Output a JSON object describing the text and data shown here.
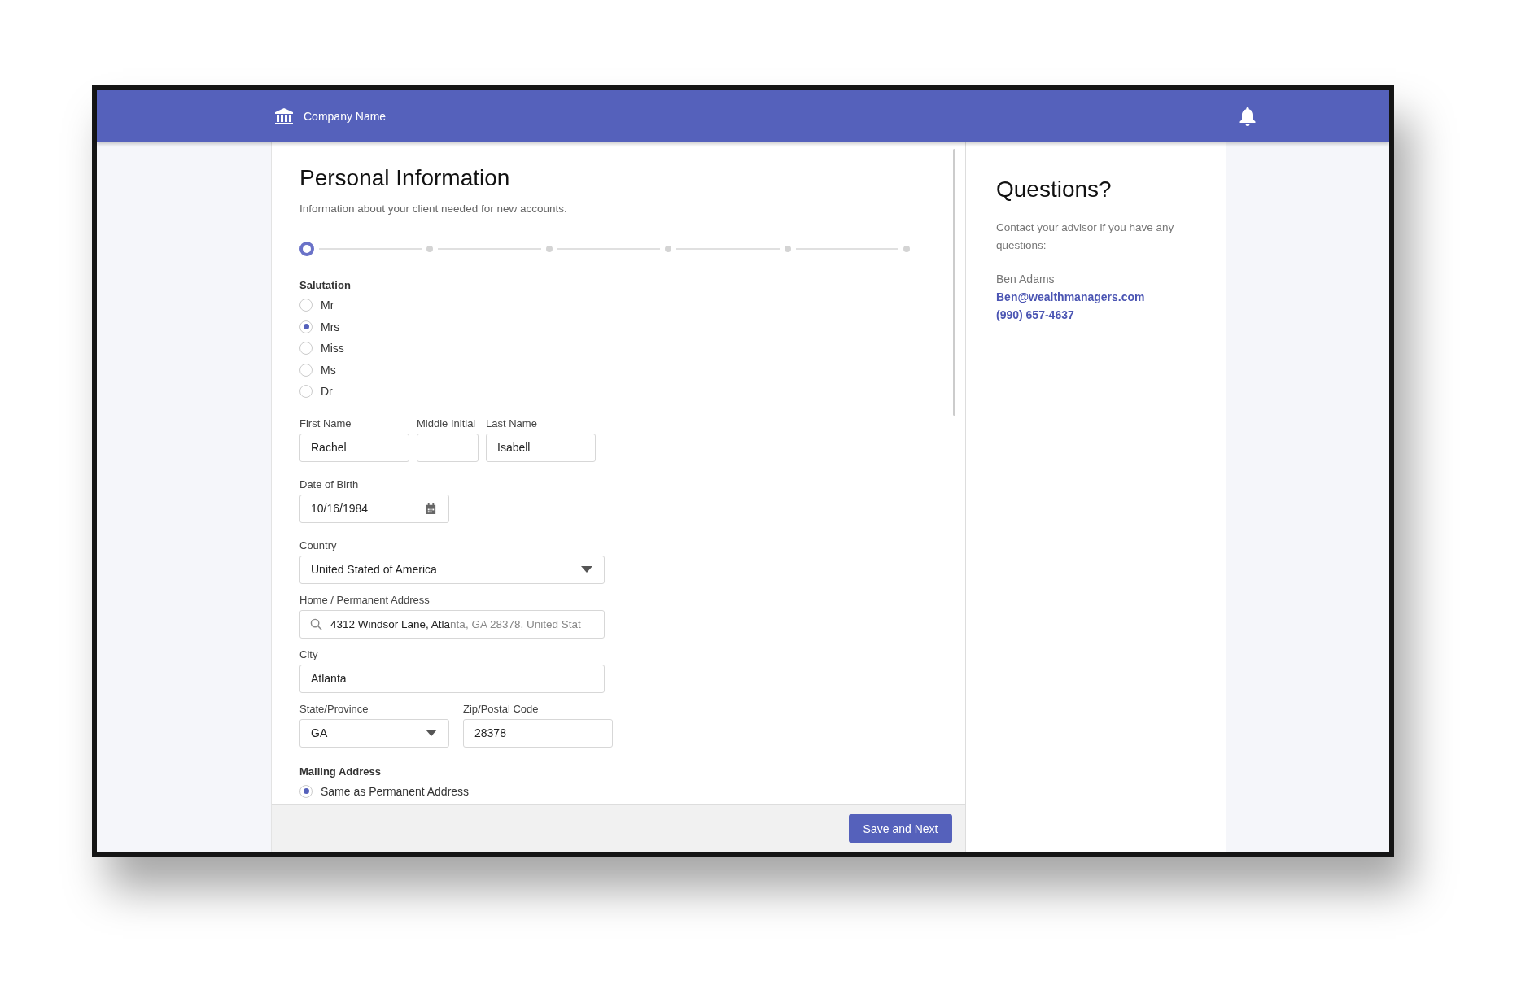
{
  "header": {
    "company": "Company Name"
  },
  "form": {
    "title": "Personal Information",
    "subtitle": "Information about your client needed for new accounts.",
    "steps": [
      {
        "selected": true
      },
      {
        "selected": false
      },
      {
        "selected": false
      },
      {
        "selected": false
      },
      {
        "selected": false
      },
      {
        "selected": false
      }
    ],
    "salutation": {
      "label": "Salutation",
      "options": [
        {
          "label": "Mr",
          "selected": false
        },
        {
          "label": "Mrs",
          "selected": true
        },
        {
          "label": "Miss",
          "selected": false
        },
        {
          "label": "Ms",
          "selected": false
        },
        {
          "label": "Dr",
          "selected": false
        }
      ]
    },
    "first_name": {
      "label": "First Name",
      "value": "Rachel"
    },
    "middle_initial": {
      "label": "Middle Initial"
    },
    "last_name": {
      "label": "Last Name",
      "value": "Isabell"
    },
    "date_of_birth": {
      "label": "Date of Birth",
      "value": "10/16/1984"
    },
    "country": {
      "label": "Country",
      "value": "United Stated of America"
    },
    "address": {
      "label": "Home / Permanent Address",
      "value": "**4312 Windsor Lane, Atla**nta, GA 28378, United Stat"
    },
    "city": {
      "label": "City",
      "value": "Atlanta"
    },
    "state": {
      "label": "State/Province",
      "value": "GA"
    },
    "zip": {
      "label": "Zip/Postal Code",
      "value": "28378"
    },
    "mailing": {
      "label": "Mailing Address",
      "options": [
        {
          "label": "Same as Permanent Address",
          "selected": true
        }
      ]
    },
    "save_button": "Save and Next"
  },
  "help": {
    "title": "Questions?",
    "text": "Contact your advisor if you have any questions:",
    "name": "Ben Adams",
    "email": "Ben@wealthmanagers.com",
    "phone": "(990) 657-4637"
  }
}
